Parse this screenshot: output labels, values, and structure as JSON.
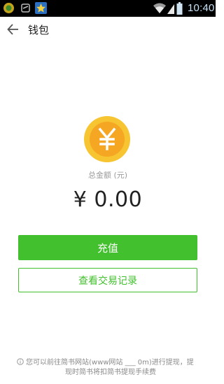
{
  "status_bar": {
    "time": "10:40",
    "icons": [
      "app-notification-icon",
      "sim-icon",
      "star-icon",
      "wifi-icon",
      "signal-icon",
      "battery-icon"
    ]
  },
  "app_bar": {
    "title": "钱包",
    "back_icon": "arrow-left-icon"
  },
  "wallet": {
    "coin_icon": "yuan-coin-icon",
    "total_label": "总金额 (元)",
    "balance": "¥ 0.00"
  },
  "actions": {
    "recharge_label": "充值",
    "records_label": "查看交易记录"
  },
  "footer": {
    "note_line1": "您可以前往简书网站(www网站 ___ 0m)进行提现，提",
    "note_line2": "现时简书将扣简书提现手续费"
  },
  "colors": {
    "accent": "#42c02e",
    "coin_outer": "#f7c531",
    "coin_inner": "#f5a623",
    "status_bar": "#000000"
  }
}
